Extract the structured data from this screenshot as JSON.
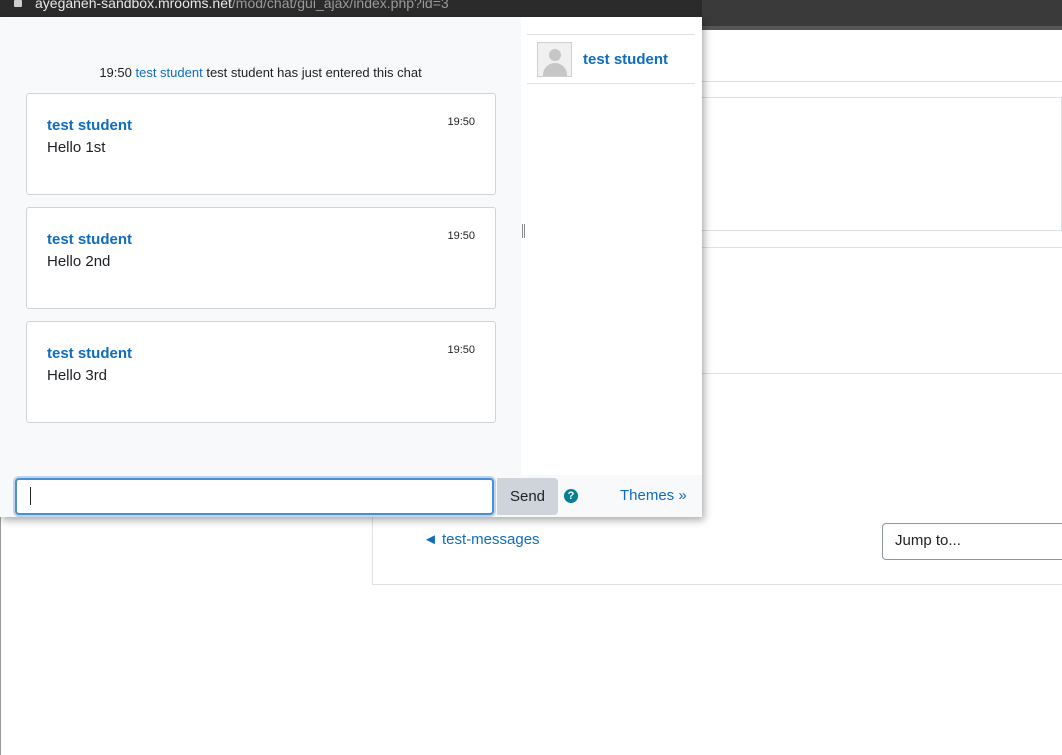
{
  "browser": {
    "url_host": "ayeganeh-sandbox.mrooms.net",
    "url_path": "/mod/chat/gui_ajax/index.php?id=3"
  },
  "chat": {
    "system_message": {
      "time": "19:50",
      "user": "test student",
      "text": "test student has just entered this chat"
    },
    "messages": [
      {
        "author": "test student",
        "time": "19:50",
        "text": "Hello 1st"
      },
      {
        "author": "test student",
        "time": "19:50",
        "text": "Hello 2nd"
      },
      {
        "author": "test student",
        "time": "19:50",
        "text": "Hello 3rd"
      }
    ]
  },
  "users": [
    {
      "name": "test student"
    }
  ],
  "input_bar": {
    "message_value": "",
    "send_label": "Send",
    "help_glyph": "?",
    "themes_label": "Themes »"
  },
  "background_page": {
    "prev_activity_link": "◄ test-messages",
    "jump_to_label": "Jump to..."
  },
  "colors": {
    "link": "#0f6cbf",
    "help_icon": "#008196",
    "input_focus": "#4b8fd8"
  }
}
